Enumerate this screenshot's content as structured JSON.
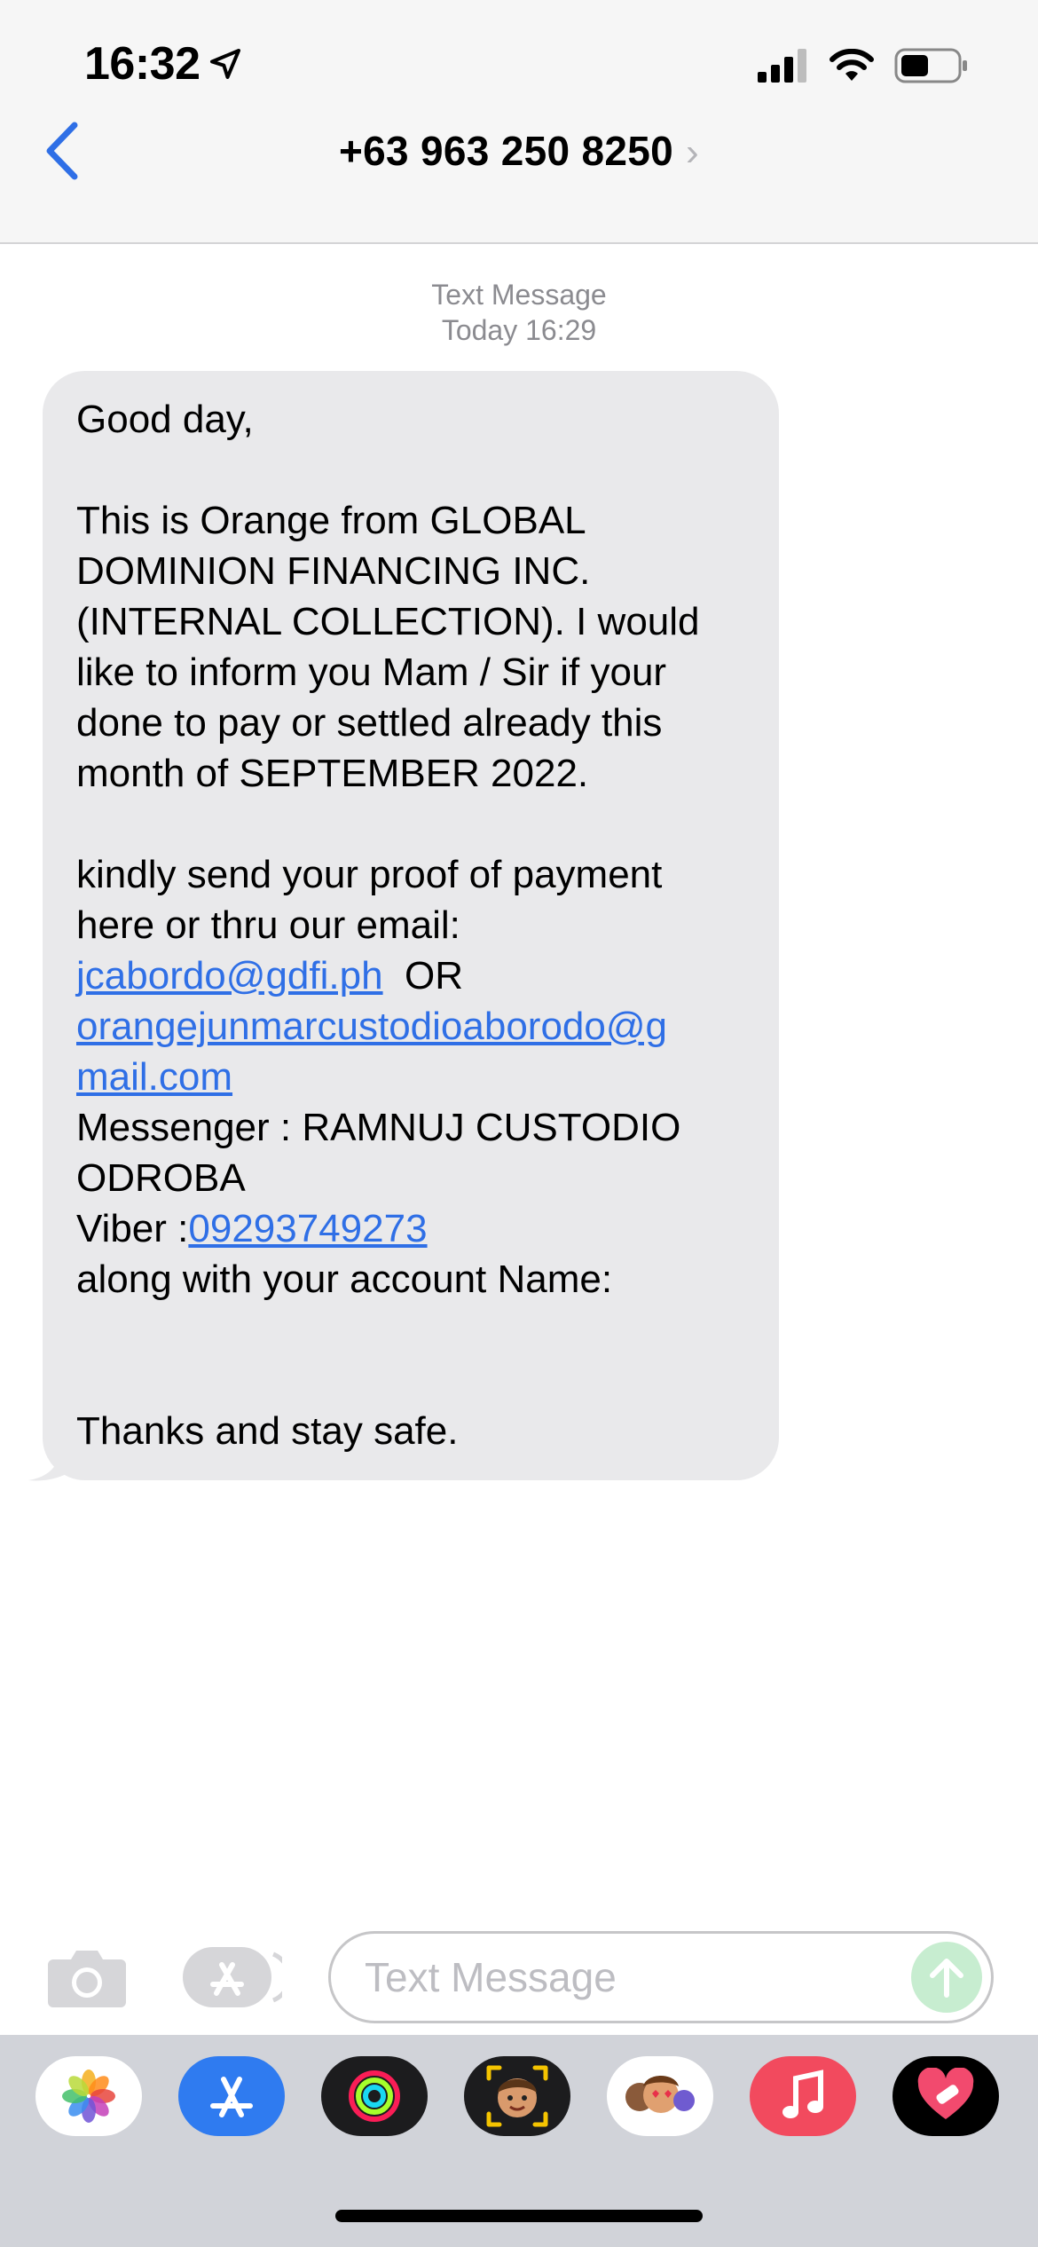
{
  "status_bar": {
    "time": "16:32"
  },
  "header": {
    "contact": "+63 963 250 8250",
    "chevron": "›"
  },
  "thread": {
    "meta_type": "Text Message",
    "meta_time": "Today 16:29"
  },
  "message": {
    "greeting": "Good day,",
    "para1_line1": "This is Orange from  GLOBAL",
    "para1_line2": "DOMINION FINANCING INC.",
    "para1_line3": "(INTERNAL COLLECTION). I would",
    "para1_line4": "like to inform you Mam / Sir  if your",
    "para1_line5": "done to pay  or settled already this",
    "para1_line6": "month of SEPTEMBER 2022.",
    "para2_line1": "kindly send your proof of payment",
    "para2_line2": "here or thru our email:",
    "email1": "jcabordo@gdfi.ph",
    "or_text": "  OR",
    "email2_line1": "orangejunmarcustodioaborodo@g",
    "email2_line2": "mail.com",
    "messenger_line1": "Messenger : RAMNUJ CUSTODIO",
    "messenger_line2": "ODROBA",
    "viber_label": "Viber :",
    "viber_number": "09293749273",
    "account_line": "along with your account Name:",
    "closing": "Thanks and stay safe."
  },
  "composer": {
    "placeholder": "Text Message"
  },
  "colors": {
    "link": "#2f6fe6",
    "bubble": "#e9e9eb",
    "accent": "#2f6fe6"
  },
  "tray_apps": [
    "photos-icon",
    "app-store-icon",
    "activity-icon",
    "memoji-icon",
    "animoji-icon",
    "music-icon",
    "heart-sticker-icon"
  ]
}
